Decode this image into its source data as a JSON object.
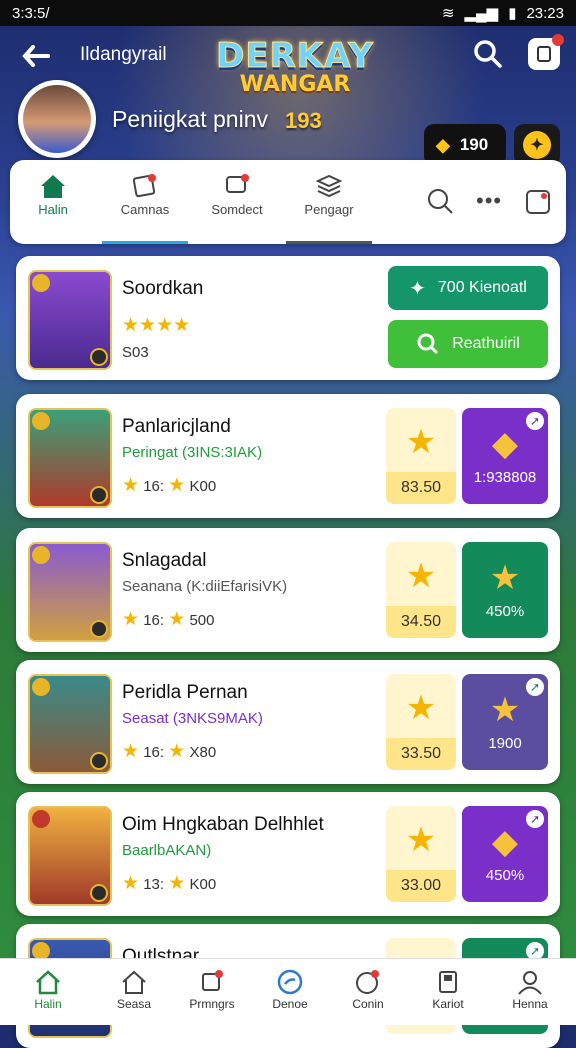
{
  "status_bar": {
    "time_left": "3:3:5/",
    "time_right": "23:23"
  },
  "header": {
    "app_name": "Ildangyrail",
    "logo_line1": "DERKAY",
    "logo_line2": "WANGAR",
    "player_name": "Peniigkat pninv",
    "player_level": "193",
    "currency_value": "190"
  },
  "tabs": [
    {
      "label": "Halin",
      "icon": "home-icon",
      "active": true
    },
    {
      "label": "Camnas",
      "icon": "cards-icon",
      "active": false
    },
    {
      "label": "Somdect",
      "icon": "chat-icon",
      "active": false
    },
    {
      "label": "Pengagr",
      "icon": "stack-icon",
      "active": false
    }
  ],
  "featured": {
    "name": "Soordkan",
    "stars": 4,
    "score": "S03",
    "button_top": "700 Kienoatl",
    "button_bottom": "Reathuiril"
  },
  "cards": [
    {
      "name": "Panlaricjland",
      "sub": "Peringat (3INS:3IAK)",
      "sub_color": "#1e9e3a",
      "stat1": "16:",
      "stat2": "K00",
      "tile_value": "83.50",
      "right_value": "1:938808",
      "right_color": "#7a2fc9",
      "portrait": "#2e8a6a"
    },
    {
      "name": "Snlagadal",
      "sub": "Seanana (K:diiEfarisiVK)",
      "sub_color": "#555555",
      "stat1": "16:",
      "stat2": "500",
      "tile_value": "34.50",
      "right_value": "450%",
      "right_color": "#138a5a",
      "portrait": "#6a3db0"
    },
    {
      "name": "Peridla Pernan",
      "sub": "Seasat (3NKS9MAK)",
      "sub_color": "#7a2fc9",
      "stat1": "16:",
      "stat2": "X80",
      "tile_value": "33.50",
      "right_value": "1900",
      "right_color": "#5b4ea0",
      "portrait": "#2a6a7a"
    },
    {
      "name": "Oim Hngkaban Delhhlet",
      "sub": "BaarlbAKAN)",
      "sub_color": "#1e9e3a",
      "stat1": "13:",
      "stat2": "K00",
      "tile_value": "33.00",
      "right_value": "450%",
      "right_color": "#7a2fc9",
      "portrait": "#e29a2a"
    },
    {
      "name": "Qutlstnar",
      "sub": "",
      "sub_color": "#333333",
      "stat1": "",
      "stat2": "",
      "tile_value": "",
      "right_value": "",
      "right_color": "#138a5a",
      "portrait": "#2a4a9a"
    }
  ],
  "bottom_nav": [
    {
      "label": "Halin",
      "icon": "home-icon",
      "active": true
    },
    {
      "label": "Seasa",
      "icon": "house-icon",
      "active": false
    },
    {
      "label": "Prmngrs",
      "icon": "cards-icon",
      "active": false
    },
    {
      "label": "Denoe",
      "icon": "compass-icon",
      "active": false
    },
    {
      "label": "Conin",
      "icon": "chat-icon",
      "active": false
    },
    {
      "label": "Kariot",
      "icon": "book-icon",
      "active": false
    },
    {
      "label": "Henna",
      "icon": "person-icon",
      "active": false
    }
  ],
  "colors": {
    "accent": "#117a50",
    "green_button": "#3fbf3a",
    "teal_button": "#15956a"
  }
}
